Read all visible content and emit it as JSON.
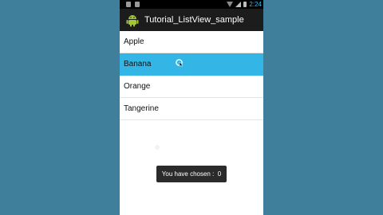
{
  "status_bar": {
    "time": "2:24",
    "icons": [
      "usb-icon",
      "sd-card-icon",
      "wifi-icon",
      "signal-icon",
      "battery-icon"
    ]
  },
  "title_bar": {
    "title": "Tutorial_ListView_sample",
    "icon": "android-icon"
  },
  "list": {
    "items": [
      {
        "label": "Apple",
        "selected": false
      },
      {
        "label": "Banana",
        "selected": true
      },
      {
        "label": "Orange",
        "selected": false
      },
      {
        "label": "Tangerine",
        "selected": false
      }
    ]
  },
  "toast": {
    "message": "You have chosen :  0"
  },
  "colors": {
    "background": "#3f7f9c",
    "accent": "#33b5e5",
    "title_bar": "#1c1c1c"
  }
}
